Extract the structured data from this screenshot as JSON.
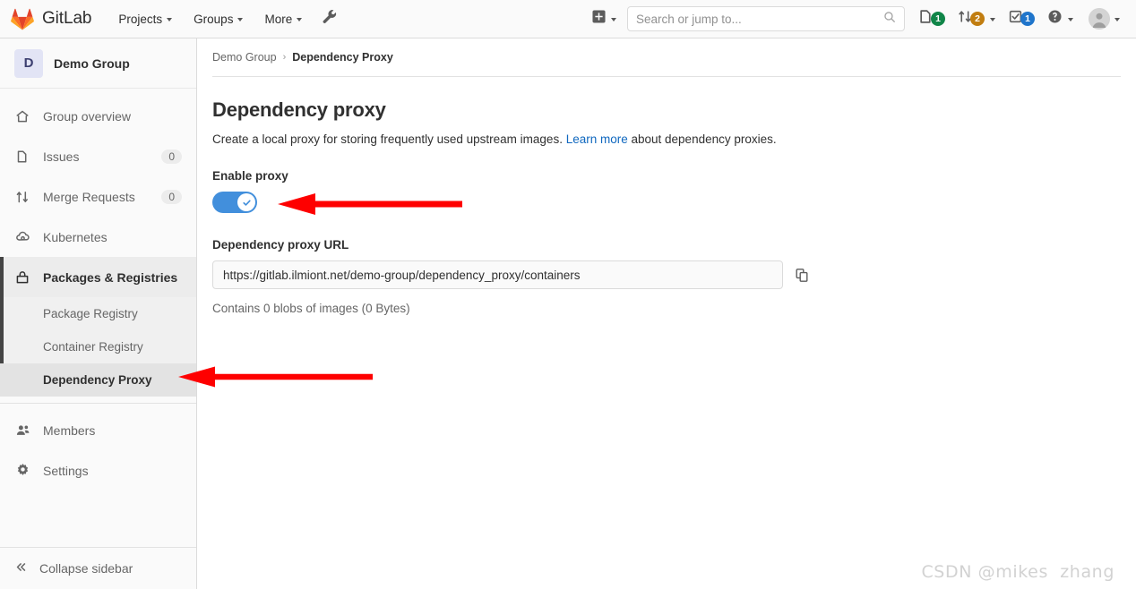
{
  "topnav": {
    "brand": "GitLab",
    "brand_logo_icon": "gitlab-logo-icon",
    "links": [
      {
        "label": "Projects",
        "icon": "chevron-down-icon"
      },
      {
        "label": "Groups",
        "icon": "chevron-down-icon"
      },
      {
        "label": "More",
        "icon": "chevron-down-icon"
      }
    ],
    "wrench_icon": "wrench-icon",
    "plus_icon": "plus-square-icon",
    "search": {
      "placeholder": "Search or jump to...",
      "value": "",
      "icon": "search-icon"
    },
    "status_icons": [
      {
        "name": "issues-icon",
        "badge": "1",
        "badge_color": "#108548",
        "has_chevron": false
      },
      {
        "name": "merge-requests-icon",
        "badge": "2",
        "badge_color": "#c17d10",
        "has_chevron": true
      },
      {
        "name": "todos-icon",
        "badge": "1",
        "badge_color": "#1f75cb",
        "has_chevron": false
      },
      {
        "name": "help-icon",
        "badge": "",
        "badge_color": "",
        "has_chevron": true
      }
    ],
    "avatar_icon": "user-avatar-icon"
  },
  "sidebar": {
    "group": {
      "initial": "D",
      "name": "Demo Group"
    },
    "items": [
      {
        "label": "Group overview",
        "icon": "home-icon",
        "count": "",
        "active": false
      },
      {
        "label": "Issues",
        "icon": "issues-icon",
        "count": "0",
        "active": false
      },
      {
        "label": "Merge Requests",
        "icon": "merge-requests-icon",
        "count": "0",
        "active": false
      },
      {
        "label": "Kubernetes",
        "icon": "kubernetes-icon",
        "count": "",
        "active": false
      },
      {
        "label": "Packages & Registries",
        "icon": "package-icon",
        "count": "",
        "active": true
      }
    ],
    "subitems": [
      {
        "label": "Package Registry",
        "active": false
      },
      {
        "label": "Container Registry",
        "active": false
      },
      {
        "label": "Dependency Proxy",
        "active": true
      }
    ],
    "items_bottom": [
      {
        "label": "Members",
        "icon": "members-icon",
        "count": "",
        "active": false
      },
      {
        "label": "Settings",
        "icon": "gear-icon",
        "count": "",
        "active": false
      }
    ],
    "collapse": {
      "label": "Collapse sidebar",
      "icon": "double-chevron-left-icon"
    }
  },
  "main": {
    "breadcrumb": {
      "parent": "Demo Group",
      "separator": "›",
      "current": "Dependency Proxy"
    },
    "title": "Dependency proxy",
    "description_before": "Create a local proxy for storing frequently used upstream images. ",
    "description_link": "Learn more",
    "description_after": " about dependency proxies.",
    "enable_label": "Enable proxy",
    "toggle_enabled": true,
    "toggle_check_icon": "check-icon",
    "url_label": "Dependency proxy URL",
    "url_value": "https://gitlab.ilmiont.net/demo-group/dependency_proxy/containers",
    "copy_icon": "copy-to-clipboard-icon",
    "blob_info": "Contains 0 blobs of images (0 Bytes)"
  },
  "annotations": {
    "arrow_color": "#fe0000",
    "arrows": [
      {
        "name": "arrow-pointing-to-enable-proxy-toggle"
      },
      {
        "name": "arrow-pointing-to-dependency-proxy-nav"
      }
    ]
  },
  "watermark": "CSDN @mikes  zhang",
  "colors": {
    "accent_blue": "#1068bf",
    "toggle_blue": "#428fdc",
    "sidebar_bg": "#fafafa"
  }
}
